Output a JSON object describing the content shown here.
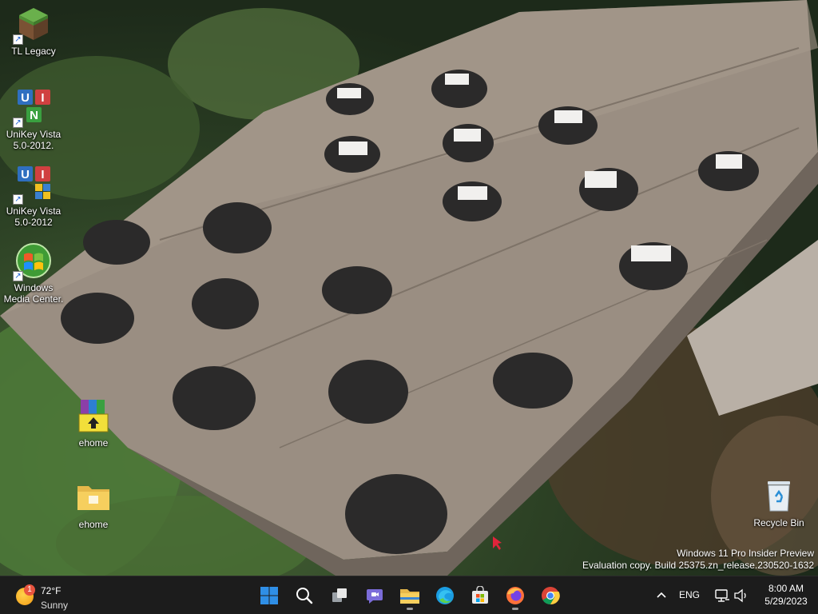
{
  "desktop": {
    "icons": [
      {
        "label": "TL Legacy",
        "icon": "minecraft-grass-block-icon"
      },
      {
        "label": "UniKey Vista 5.0-2012.",
        "icon": "unikey-icon"
      },
      {
        "label": "UniKey Vista 5.0-2012",
        "icon": "unikey-installer-icon"
      },
      {
        "label": "Windows Media Center.",
        "icon": "windows-media-center-icon"
      },
      {
        "label": "ehome",
        "icon": "winrar-archive-icon"
      },
      {
        "label": "ehome",
        "icon": "folder-icon"
      },
      {
        "label": "Recycle Bin",
        "icon": "recycle-bin-icon"
      }
    ]
  },
  "watermark": {
    "line1": "Windows 11 Pro Insider Preview",
    "line2": "Evaluation copy. Build 25375.zn_release.230520-1632"
  },
  "taskbar": {
    "weather": {
      "temp": "72°F",
      "condition": "Sunny",
      "badge": "1"
    },
    "apps": [
      {
        "name": "Start",
        "icon": "windows-start-icon"
      },
      {
        "name": "Search",
        "icon": "search-icon"
      },
      {
        "name": "Task View",
        "icon": "task-view-icon"
      },
      {
        "name": "Chat",
        "icon": "teams-chat-icon"
      },
      {
        "name": "File Explorer",
        "icon": "file-explorer-icon"
      },
      {
        "name": "Microsoft Edge",
        "icon": "edge-icon"
      },
      {
        "name": "Microsoft Store",
        "icon": "store-icon"
      },
      {
        "name": "Firefox",
        "icon": "firefox-icon"
      },
      {
        "name": "Chrome",
        "icon": "chrome-icon"
      }
    ],
    "tray": {
      "language": "ENG",
      "time": "8:00 AM",
      "date": "5/29/2023"
    },
    "colors": {
      "background": "#1c1c1c",
      "start_blue": "#2f8fe6"
    }
  }
}
